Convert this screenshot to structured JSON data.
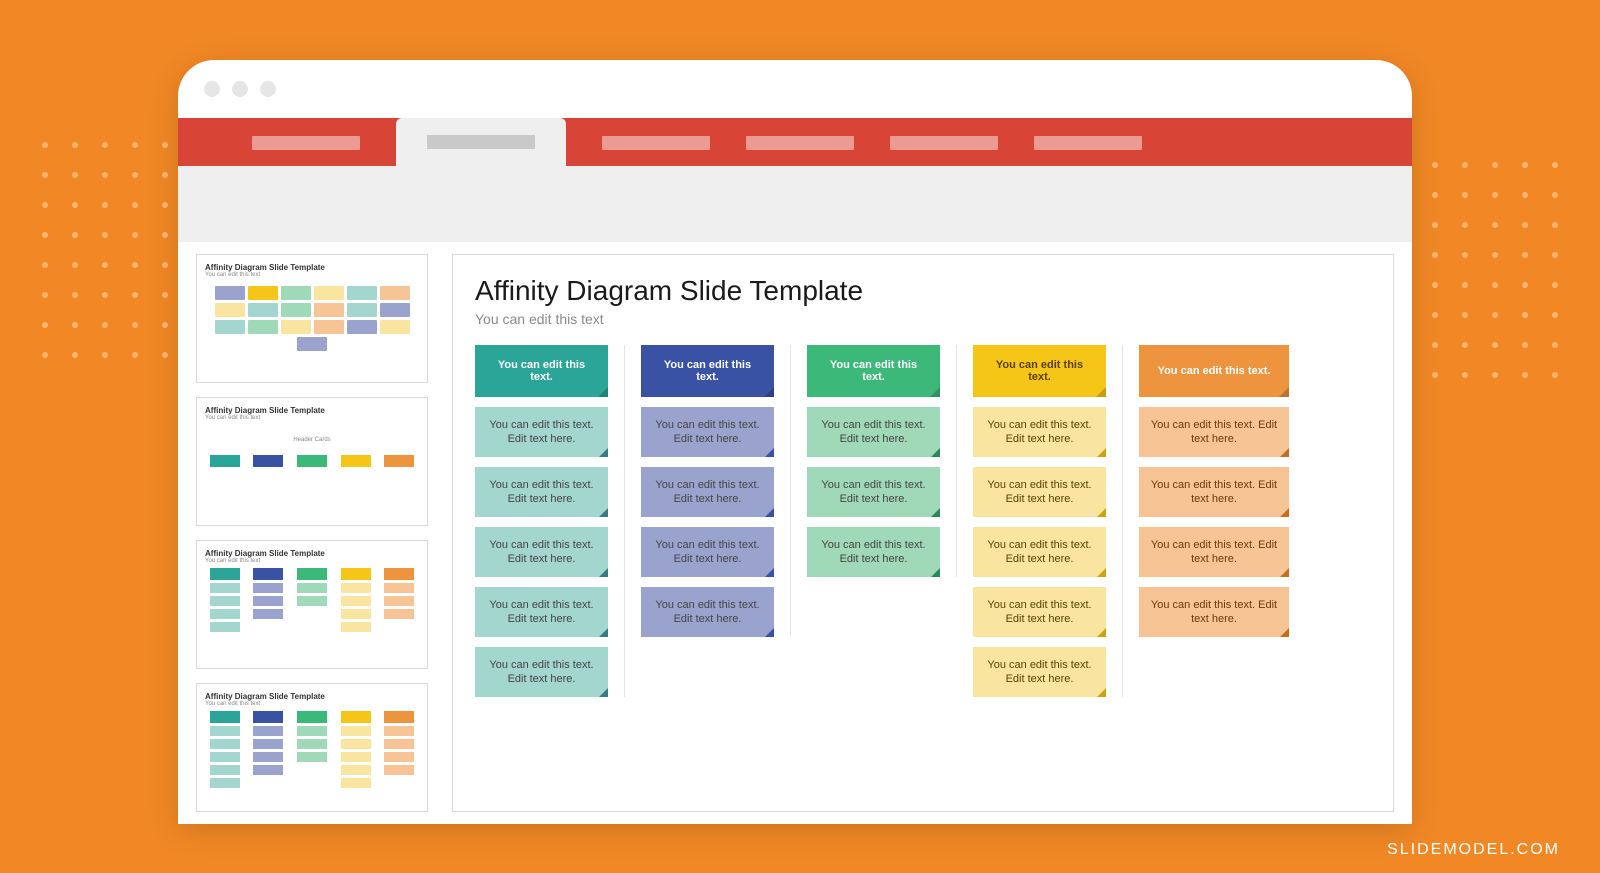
{
  "watermark": "SLIDEMODEL.COM",
  "thumbnails": [
    {
      "title": "Affinity Diagram Slide Template",
      "subtitle": "You can edit this text"
    },
    {
      "title": "Affinity Diagram Slide Template",
      "subtitle": "You can edit this text",
      "label": "Header Cards"
    },
    {
      "title": "Affinity Diagram Slide Template",
      "subtitle": "You can edit this text"
    },
    {
      "title": "Affinity Diagram Slide Template",
      "subtitle": "You can edit this text"
    }
  ],
  "slide": {
    "title": "Affinity Diagram Slide Template",
    "subtitle": "You can edit this text",
    "columns": [
      {
        "color": "teal",
        "header": "You can edit this text.",
        "cards": [
          "You can edit this text. Edit text here.",
          "You can edit this text. Edit text here.",
          "You can edit this text. Edit text here.",
          "You can edit this text. Edit text here.",
          "You can edit this text. Edit text here."
        ]
      },
      {
        "color": "indigo",
        "header": "You can edit this text.",
        "cards": [
          "You can edit this text. Edit text here.",
          "You can edit this text. Edit text here.",
          "You can edit this text. Edit text here.",
          "You can edit this text. Edit text here."
        ]
      },
      {
        "color": "green",
        "header": "You can edit this text.",
        "cards": [
          "You can edit this text. Edit text here.",
          "You can edit this text. Edit text here.",
          "You can edit this text. Edit text here."
        ]
      },
      {
        "color": "yellow",
        "header": "You can edit this text.",
        "cards": [
          "You can edit this text. Edit text here.",
          "You can edit this text. Edit text here.",
          "You can edit this text. Edit text here.",
          "You can edit this text. Edit text here.",
          "You can edit this text. Edit text here."
        ]
      },
      {
        "color": "orange",
        "header": "You can edit this text.",
        "cards": [
          "You can edit this text. Edit text here.",
          "You can edit this text. Edit text here.",
          "You can edit this text. Edit text here.",
          "You can edit this text. Edit text here."
        ]
      }
    ]
  },
  "palette": {
    "teal": "#2aa598",
    "indigo": "#3952a4",
    "green": "#3cb878",
    "yellow": "#f5c518",
    "orange": "#ee933e"
  }
}
